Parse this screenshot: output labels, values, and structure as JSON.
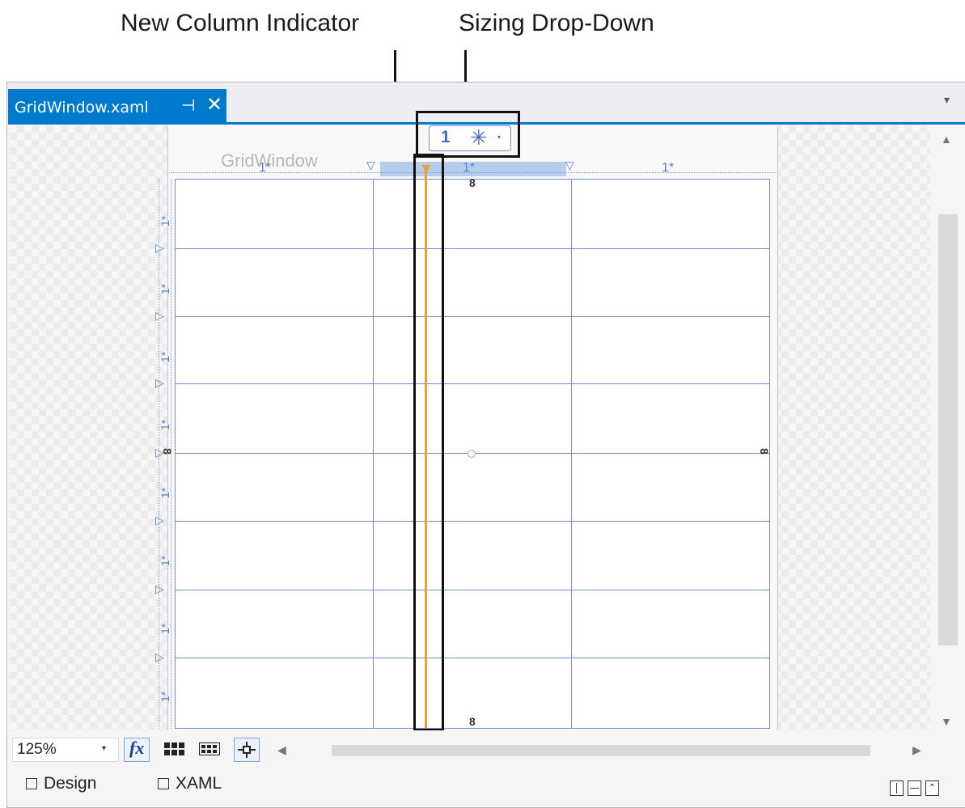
{
  "callouts": {
    "new_column_indicator": "New Column Indicator",
    "sizing_dropdown": "Sizing Drop-Down"
  },
  "document_tab": {
    "title": "GridWindow.xaml",
    "pin_icon": "pin-icon",
    "close_icon": "close-icon",
    "pin_glyph": "⊣",
    "close_glyph": "✕"
  },
  "designer": {
    "window_title": "GridWindow",
    "column_sizes": [
      "1*",
      "1*",
      "1*"
    ],
    "row_sizes": [
      "1*",
      "1*",
      "1*",
      "1*",
      "1*",
      "1*",
      "1*",
      "1*"
    ],
    "sizing_dropdown": {
      "value": "1",
      "unit_glyph": "✳",
      "arrow": "▾"
    },
    "new_column_marker": "▼",
    "accent_color": "#f0a030",
    "grid_color": "#6f8fc4"
  },
  "toolbar": {
    "zoom": "125%",
    "zoom_arrow": "▾",
    "fx_label": "fx",
    "buttons": [
      "fx-icon",
      "grid-lines-icon",
      "artboard-background-icon",
      "snap-to-gridlines-icon"
    ]
  },
  "scrollbars": {
    "up": "▲",
    "down": "▼",
    "left": "◀",
    "right": "▶"
  },
  "view_tabs": {
    "design": "Design",
    "xaml": "XAML"
  },
  "tab_overflow": "▾"
}
